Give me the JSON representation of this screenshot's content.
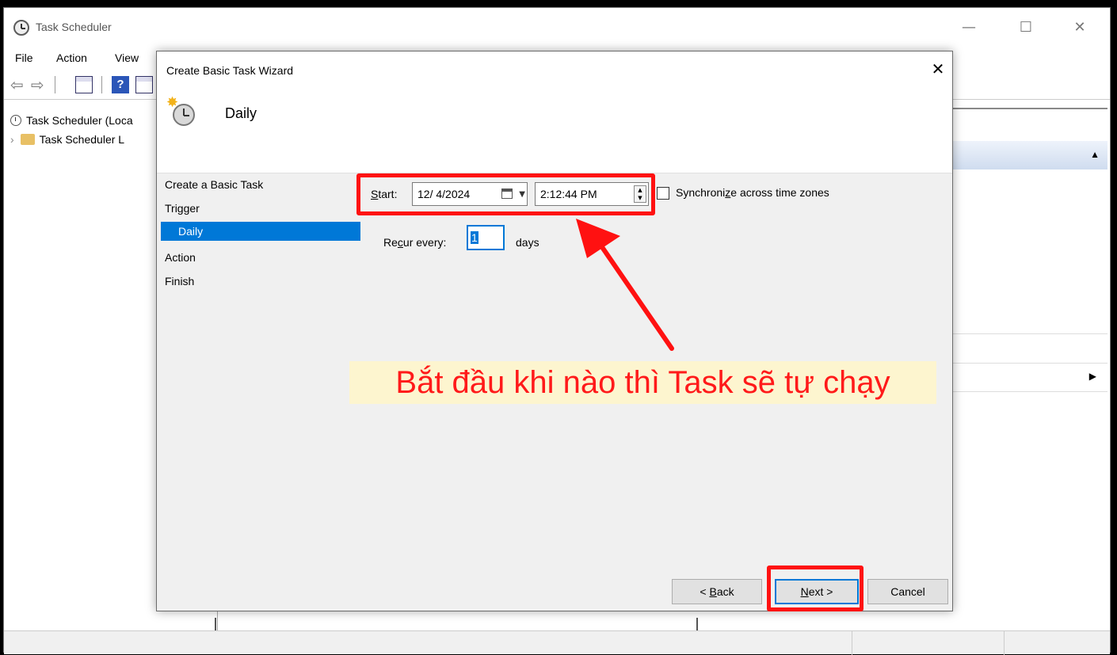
{
  "app": {
    "title": "Task Scheduler",
    "minimize": "—",
    "maximize": "☐",
    "close": "✕"
  },
  "menu": [
    "File",
    "Action",
    "View"
  ],
  "tree": {
    "root": "Task Scheduler (Loca",
    "child": "Task Scheduler L"
  },
  "dialog": {
    "title": "Create Basic Task Wizard",
    "close": "✕",
    "heading": "Daily",
    "steps": [
      "Create a Basic Task",
      "Trigger",
      "Daily",
      "Action",
      "Finish"
    ],
    "selected_step": "Daily",
    "start": {
      "label_key": "S",
      "label_rest": "tart:",
      "date": "12/  4/2024",
      "time": "2:12:44 PM"
    },
    "sync": {
      "label_pre": "Synchroni",
      "label_key": "z",
      "label_post": "e across time zones",
      "checked": false
    },
    "recur": {
      "label_pre": "Re",
      "label_key": "c",
      "label_post": "ur every:",
      "value": "1",
      "unit": "days"
    },
    "buttons": {
      "back_pre": "< ",
      "back_key": "B",
      "back_post": "ack",
      "next_key": "N",
      "next_post": "ext >",
      "cancel": "Cancel"
    }
  },
  "annotation": {
    "callout": "Bắt đầu khi nào thì Task sẽ tự chạy",
    "color": "#ff1111"
  },
  "colors": {
    "selection": "#0078d7",
    "dialog_bg": "#f0f0f0"
  }
}
